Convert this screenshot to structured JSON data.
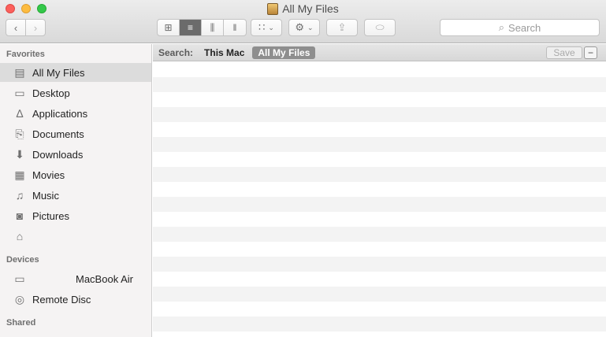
{
  "window": {
    "title": "All My Files"
  },
  "toolbar": {
    "back_icon": "chevron-left-icon",
    "forward_icon": "chevron-right-icon",
    "view_modes": [
      "icon-view",
      "list-view",
      "column-view",
      "coverflow-view"
    ],
    "active_view": "list-view",
    "search_placeholder": "Search"
  },
  "sidebar": {
    "favorites_header": "Favorites",
    "favorites": [
      {
        "label": "All My Files",
        "icon": "all-files-icon",
        "selected": true
      },
      {
        "label": "Desktop",
        "icon": "desktop-icon"
      },
      {
        "label": "Applications",
        "icon": "applications-icon"
      },
      {
        "label": "Documents",
        "icon": "documents-icon"
      },
      {
        "label": "Downloads",
        "icon": "downloads-icon"
      },
      {
        "label": "Movies",
        "icon": "movies-icon"
      },
      {
        "label": "Music",
        "icon": "music-icon"
      },
      {
        "label": "Pictures",
        "icon": "pictures-icon"
      },
      {
        "label": "",
        "icon": "home-icon"
      }
    ],
    "devices_header": "Devices",
    "devices": [
      {
        "label": "MacBook Air",
        "icon": "laptop-icon"
      },
      {
        "label": "Remote Disc",
        "icon": "disc-icon"
      }
    ],
    "shared_header": "Shared"
  },
  "scope": {
    "label": "Search:",
    "this_mac": "This Mac",
    "all_my_files": "All My Files",
    "save": "Save",
    "minus": "−"
  },
  "colors": {
    "selected_scope": "#8e8e8e",
    "row_stripe": "#f3f3f3"
  }
}
